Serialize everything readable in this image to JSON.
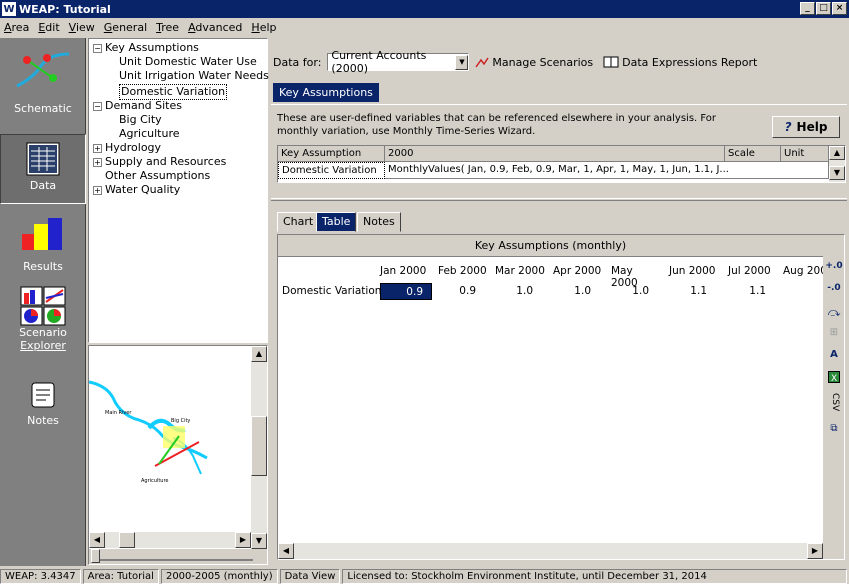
{
  "window": {
    "title": "WEAP: Tutorial",
    "logo": "W"
  },
  "menu": [
    "Area",
    "Edit",
    "View",
    "General",
    "Tree",
    "Advanced",
    "Help"
  ],
  "sidebar": {
    "items": [
      {
        "label": "Schematic",
        "icon": "schematic-icon"
      },
      {
        "label": "Data",
        "icon": "data-icon"
      },
      {
        "label": "Results",
        "icon": "results-icon"
      },
      {
        "label": "Scenario\nExplorer",
        "label1": "Scenario",
        "label2": "Explorer",
        "icon": "scenario-explorer-icon"
      },
      {
        "label": "Notes",
        "icon": "notes-icon"
      }
    ]
  },
  "tree": {
    "items": [
      {
        "label": "Key Assumptions",
        "expander": "−"
      },
      {
        "label": "Unit Domestic Water Use"
      },
      {
        "label": "Unit Irrigation Water Needs"
      },
      {
        "label": "Domestic Variation",
        "selected": true
      },
      {
        "label": "Demand Sites",
        "expander": "−"
      },
      {
        "label": "Big City"
      },
      {
        "label": "Agriculture"
      },
      {
        "label": "Hydrology",
        "expander": "+"
      },
      {
        "label": "Supply and Resources",
        "expander": "+"
      },
      {
        "label": "Other Assumptions"
      },
      {
        "label": "Water Quality",
        "expander": "+"
      }
    ]
  },
  "minimap": {
    "labels": [
      "Main River",
      "Big City",
      "Agriculture"
    ]
  },
  "datafor": {
    "label": "Data for:",
    "value": "Current Accounts (2000)",
    "manage_scenarios": "Manage Scenarios",
    "expressions_report": "Data Expressions Report"
  },
  "topTab": "Key Assumptions",
  "description": "These are user-defined variables that can be referenced elsewhere in your analysis.  For monthly variation, use Monthly Time-Series Wizard.",
  "help": "Help",
  "grid": {
    "headers": [
      "Key Assumption",
      "2000",
      "Scale",
      "Unit"
    ],
    "row": [
      "Domestic Variation",
      "MonthlyValues( Jan, 0.9,  Feb, 0.9,  Mar, 1,  Apr, 1,  May, 1,  Jun, 1.1,  J..."
    ]
  },
  "bottomTabs": [
    "Chart",
    "Table",
    "Notes"
  ],
  "table": {
    "title": "Key Assumptions (monthly)",
    "months": [
      "Jan 2000",
      "Feb 2000",
      "Mar 2000",
      "Apr 2000",
      "May 2000",
      "Jun 2000",
      "Jul 2000",
      "Aug 200"
    ],
    "rowLabel": "Domestic Variation",
    "values": [
      "0.9",
      "0.9",
      "1.0",
      "1.0",
      "1.0",
      "1.1",
      "1.1",
      ""
    ]
  },
  "tools": [
    ".00 increase-decimals-icon",
    ".00 decrease-decimals-icon",
    "chart-toggle-icon",
    "filter-icon",
    "font-icon",
    "excel-icon",
    "CSV",
    "copy-icon"
  ],
  "toolsLabels": {
    "csv": "CSV"
  },
  "status": [
    "WEAP: 3.4347",
    "Area: Tutorial",
    "2000-2005 (monthly)",
    "Data View",
    "Licensed to: Stockholm Environment Institute, until December 31, 2014"
  ]
}
